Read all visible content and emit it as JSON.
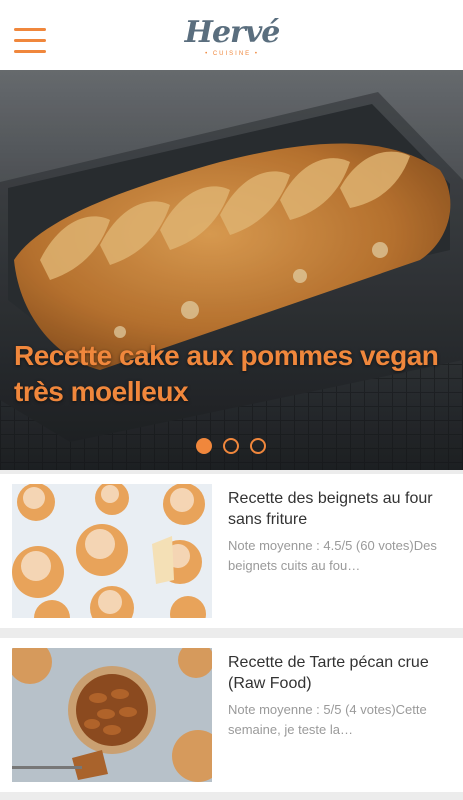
{
  "header": {
    "logo_text": "Hervé",
    "logo_subtitle": "• CUISINE •",
    "menu_icon": "hamburger-menu-icon",
    "accent_color": "#f0873c"
  },
  "hero": {
    "title_line1": "Recette cake aux pommes vegan",
    "title_line2": "très moelleux",
    "dots_count": 3,
    "active_dot": 1
  },
  "recipes": [
    {
      "title": "Recette des beignets au four sans friture",
      "description": "Note moyenne : 4.5/5 (60 votes)Des beignets cuits au fou…"
    },
    {
      "title": "Recette de Tarte pécan crue (Raw Food)",
      "description": "Note moyenne : 5/5 (4 votes)Cette semaine, je teste la…"
    }
  ]
}
